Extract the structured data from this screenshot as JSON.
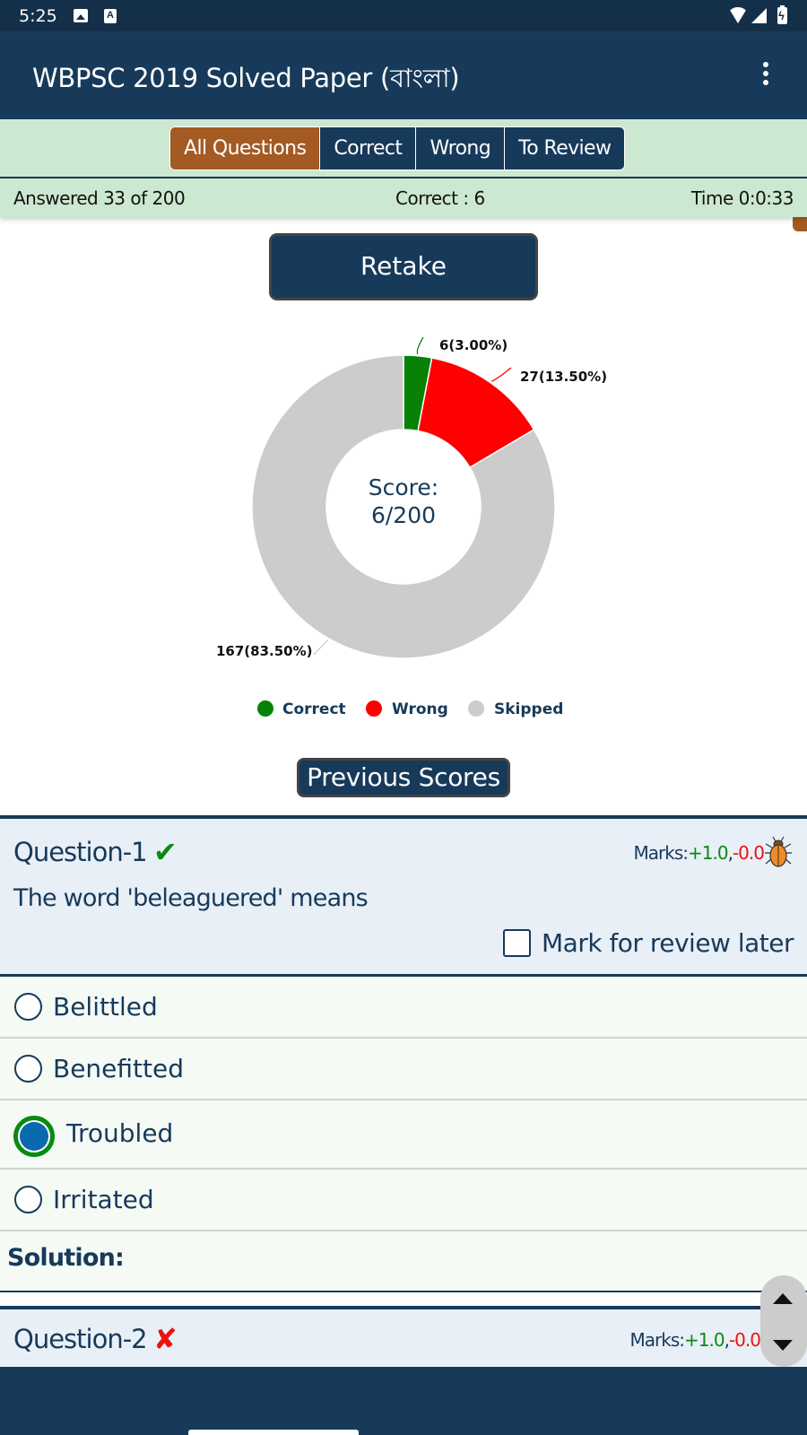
{
  "status_bar": {
    "time": "5:25",
    "left_icons": [
      "image-icon",
      "a-icon"
    ],
    "right_icons": [
      "wifi-icon",
      "signal-icon",
      "battery-charging-icon"
    ],
    "a_icon_glyph": "A"
  },
  "app_bar": {
    "title": "WBPSC 2019 Solved Paper (বাংলা)",
    "menu_icon": "more-vert-icon"
  },
  "filter_tabs": [
    {
      "label": "All Questions",
      "active": true
    },
    {
      "label": "Correct",
      "active": false
    },
    {
      "label": "Wrong",
      "active": false
    },
    {
      "label": "To Review",
      "active": false
    }
  ],
  "stats": {
    "answered": "Answered 33 of 200",
    "correct": "Correct : 6",
    "time": "Time 0:0:33"
  },
  "actions": {
    "retake_label": "Retake",
    "previous_scores_label": "Previous Scores"
  },
  "chart_data": {
    "type": "pie",
    "variant": "donut",
    "categories": [
      "Correct",
      "Wrong",
      "Skipped"
    ],
    "values": [
      6,
      27,
      167
    ],
    "percentages": [
      3.0,
      13.5,
      83.5
    ],
    "labels": [
      "6(3.00%)",
      "27(13.50%)",
      "167(83.50%)"
    ],
    "colors": [
      "#078207",
      "#ff0000",
      "#cccccc"
    ],
    "center_text": [
      "Score:",
      "6/200"
    ],
    "legend": {
      "entries": [
        "Correct",
        "Wrong",
        "Skipped"
      ],
      "placement": "bottom"
    },
    "title": ""
  },
  "questions": [
    {
      "title": "Question-1",
      "status": "correct",
      "status_icon": "✔",
      "marks_label": "Marks:",
      "marks_positive": "+1.0",
      "marks_separator": ",",
      "marks_negative": "-0.0",
      "report_icon": "bug-icon",
      "text": "The word 'beleaguered' means",
      "review_label": "Mark for review later",
      "review_checked": false,
      "options": [
        {
          "label": "Belittled",
          "selected": false
        },
        {
          "label": "Benefitted",
          "selected": false
        },
        {
          "label": "Troubled",
          "selected": true
        },
        {
          "label": "Irritated",
          "selected": false
        }
      ],
      "solution_label": "Solution:"
    },
    {
      "title": "Question-2",
      "status": "wrong",
      "status_icon": "✘",
      "marks_label": "Marks:",
      "marks_positive": "+1.0",
      "marks_separator": ",",
      "marks_negative": "-0.0"
    }
  ],
  "scroll_control": {
    "up_icon": "arrow-up-icon",
    "down_icon": "arrow-down-icon"
  }
}
